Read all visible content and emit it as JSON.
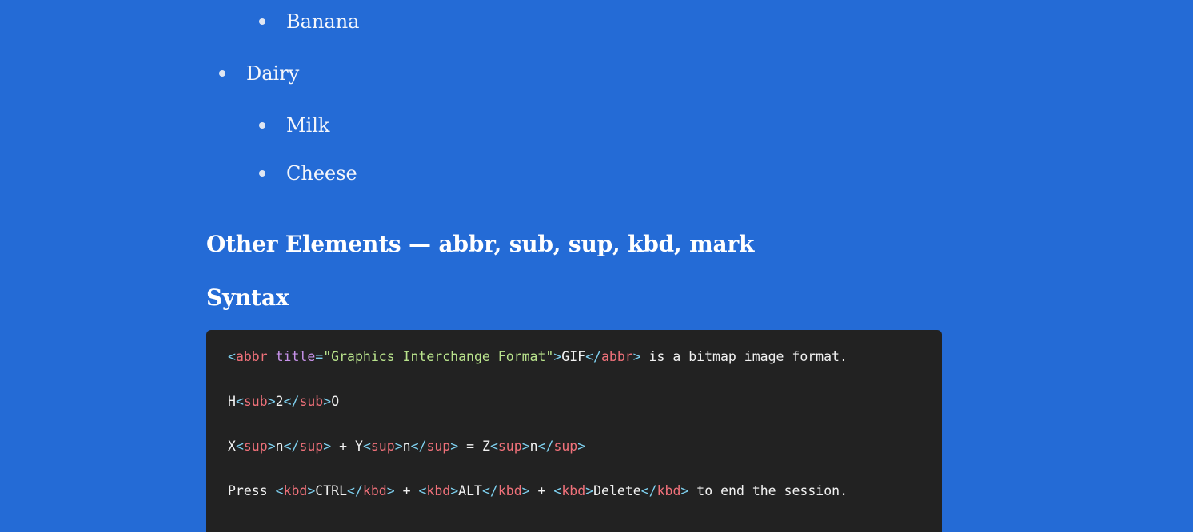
{
  "list": {
    "items": [
      {
        "label": "Banana",
        "level": 2
      },
      {
        "label": "Dairy",
        "level": 1
      },
      {
        "label": "Milk",
        "level": 2
      },
      {
        "label": "Cheese",
        "level": 2
      }
    ]
  },
  "headings": {
    "other_elements": "Other Elements — abbr, sub, sup, kbd, mark",
    "syntax": "Syntax"
  },
  "code": {
    "lines": [
      [
        {
          "t": "<",
          "c": "br"
        },
        {
          "t": "abbr",
          "c": "tag"
        },
        {
          "t": " ",
          "c": "txt"
        },
        {
          "t": "title",
          "c": "attr"
        },
        {
          "t": "=",
          "c": "br"
        },
        {
          "t": "\"Graphics Interchange Format\"",
          "c": "str"
        },
        {
          "t": ">",
          "c": "br"
        },
        {
          "t": "GIF",
          "c": "txt"
        },
        {
          "t": "</",
          "c": "br"
        },
        {
          "t": "abbr",
          "c": "tag"
        },
        {
          "t": ">",
          "c": "br"
        },
        {
          "t": " is a bitmap image format.",
          "c": "txt"
        }
      ],
      [
        {
          "t": "H",
          "c": "txt"
        },
        {
          "t": "<",
          "c": "br"
        },
        {
          "t": "sub",
          "c": "tag"
        },
        {
          "t": ">",
          "c": "br"
        },
        {
          "t": "2",
          "c": "txt"
        },
        {
          "t": "</",
          "c": "br"
        },
        {
          "t": "sub",
          "c": "tag"
        },
        {
          "t": ">",
          "c": "br"
        },
        {
          "t": "O",
          "c": "txt"
        }
      ],
      [
        {
          "t": "X",
          "c": "txt"
        },
        {
          "t": "<",
          "c": "br"
        },
        {
          "t": "sup",
          "c": "tag"
        },
        {
          "t": ">",
          "c": "br"
        },
        {
          "t": "n",
          "c": "txt"
        },
        {
          "t": "</",
          "c": "br"
        },
        {
          "t": "sup",
          "c": "tag"
        },
        {
          "t": ">",
          "c": "br"
        },
        {
          "t": " + Y",
          "c": "txt"
        },
        {
          "t": "<",
          "c": "br"
        },
        {
          "t": "sup",
          "c": "tag"
        },
        {
          "t": ">",
          "c": "br"
        },
        {
          "t": "n",
          "c": "txt"
        },
        {
          "t": "</",
          "c": "br"
        },
        {
          "t": "sup",
          "c": "tag"
        },
        {
          "t": ">",
          "c": "br"
        },
        {
          "t": " = Z",
          "c": "txt"
        },
        {
          "t": "<",
          "c": "br"
        },
        {
          "t": "sup",
          "c": "tag"
        },
        {
          "t": ">",
          "c": "br"
        },
        {
          "t": "n",
          "c": "txt"
        },
        {
          "t": "</",
          "c": "br"
        },
        {
          "t": "sup",
          "c": "tag"
        },
        {
          "t": ">",
          "c": "br"
        }
      ],
      [
        {
          "t": "Press ",
          "c": "txt"
        },
        {
          "t": "<",
          "c": "br"
        },
        {
          "t": "kbd",
          "c": "tag"
        },
        {
          "t": ">",
          "c": "br"
        },
        {
          "t": "CTRL",
          "c": "txt"
        },
        {
          "t": "</",
          "c": "br"
        },
        {
          "t": "kbd",
          "c": "tag"
        },
        {
          "t": ">",
          "c": "br"
        },
        {
          "t": " + ",
          "c": "txt"
        },
        {
          "t": "<",
          "c": "br"
        },
        {
          "t": "kbd",
          "c": "tag"
        },
        {
          "t": ">",
          "c": "br"
        },
        {
          "t": "ALT",
          "c": "txt"
        },
        {
          "t": "</",
          "c": "br"
        },
        {
          "t": "kbd",
          "c": "tag"
        },
        {
          "t": ">",
          "c": "br"
        },
        {
          "t": " + ",
          "c": "txt"
        },
        {
          "t": "<",
          "c": "br"
        },
        {
          "t": "kbd",
          "c": "tag"
        },
        {
          "t": ">",
          "c": "br"
        },
        {
          "t": "Delete",
          "c": "txt"
        },
        {
          "t": "</",
          "c": "br"
        },
        {
          "t": "kbd",
          "c": "tag"
        },
        {
          "t": ">",
          "c": "br"
        },
        {
          "t": " to end the session.",
          "c": "txt"
        }
      ]
    ]
  },
  "colors": {
    "page_bg": "#246bd6",
    "code_bg": "#222222",
    "code_text": "#f1f1f1",
    "code_tag": "#f0717a",
    "code_bracket": "#7fd1f0",
    "code_attr": "#c792ea",
    "code_string": "#b9e38c"
  }
}
